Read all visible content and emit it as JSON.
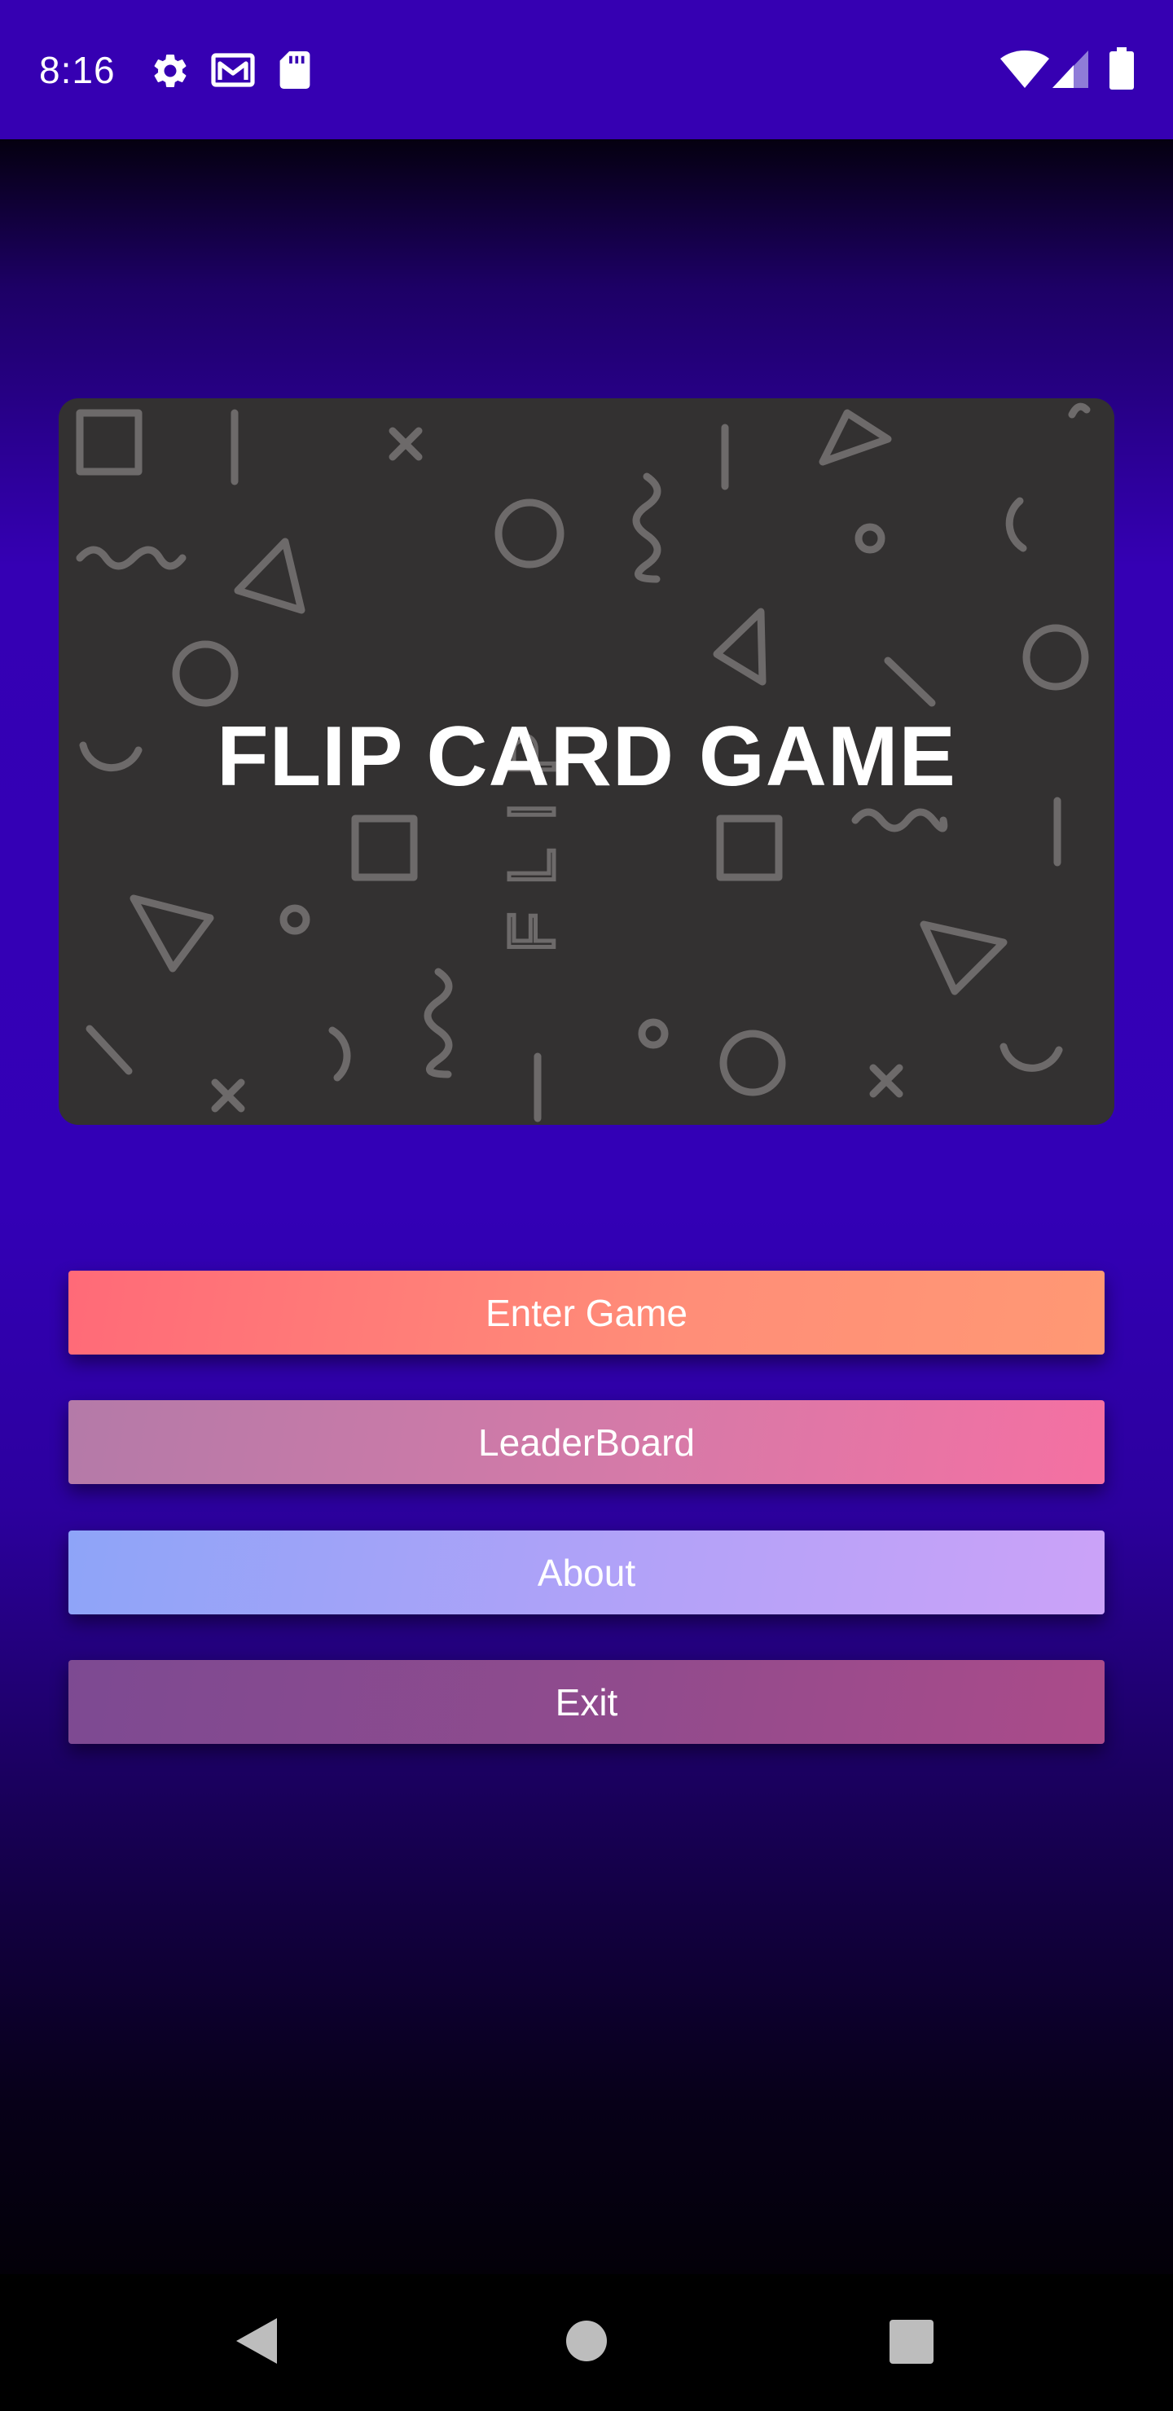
{
  "status_bar": {
    "time": "8:16",
    "left_icons": [
      "gear-icon",
      "gmail-icon",
      "sd-card-icon"
    ],
    "right_icons": [
      "wifi-icon",
      "cell-signal-icon",
      "battery-icon"
    ],
    "color": "#3600b2"
  },
  "hero": {
    "title": "FLIP CARD GAME",
    "pattern_text": "FLIP",
    "background": "#333131"
  },
  "menu": {
    "enter_game": "Enter Game",
    "leaderboard": "LeaderBoard",
    "about": "About",
    "exit": "Exit"
  },
  "nav_bar": {
    "buttons": [
      "back-icon",
      "home-icon",
      "recents-icon"
    ]
  }
}
